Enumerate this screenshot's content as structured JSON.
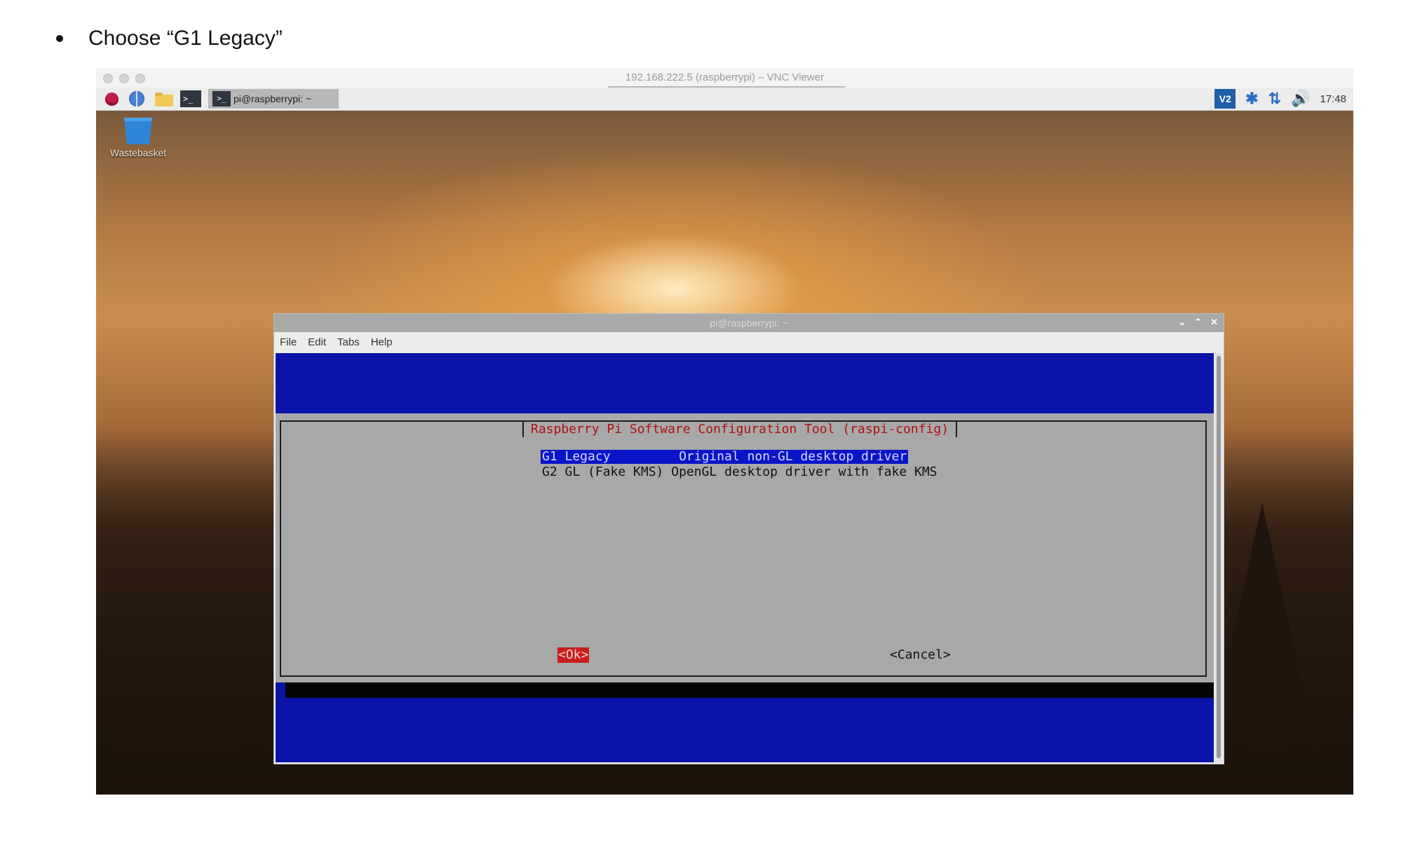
{
  "instruction": "Choose “G1 Legacy”",
  "vnc": {
    "title": "192.168.222.5 (raspberrypi) – VNC Viewer"
  },
  "taskbar": {
    "task_label": "pi@raspberrypi: ~",
    "clock": "17:48",
    "tray_vnc": "V2"
  },
  "desktop": {
    "wastebasket_label": "Wastebasket"
  },
  "terminal": {
    "title": "pi@raspberrypi: ~",
    "menu": [
      "File",
      "Edit",
      "Tabs",
      "Help"
    ]
  },
  "dialog": {
    "title": "Raspberry Pi Software Configuration Tool (raspi-config)",
    "options": [
      {
        "code": "G1 Legacy",
        "text": "G1 Legacy         Original non-GL desktop driver",
        "selected": true
      },
      {
        "code": "G2 GL (Fake KMS)",
        "text": "G2 GL (Fake KMS) OpenGL desktop driver with fake KMS",
        "selected": false
      }
    ],
    "ok_label": "<Ok>",
    "cancel_label": "<Cancel>"
  },
  "colors": {
    "terminal_bg": "#0a14a8",
    "dialog_bg": "#a8a8a8",
    "title_red": "#b01010",
    "selection": "#0a14c8",
    "ok_red": "#c81e1e"
  }
}
